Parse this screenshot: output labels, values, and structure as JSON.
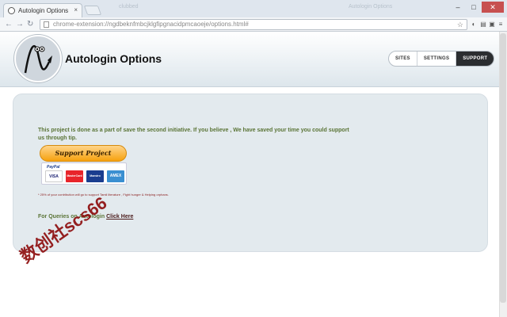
{
  "browser": {
    "tab_title": "Autologin Options",
    "tab_close": "×",
    "faded_tabs": [
      "clubbed",
      "Autologin Options"
    ],
    "url": "chrome-extension://ngdbeknfmbcjklgfipgnacidpmcaoeje/options.html#",
    "nav": {
      "back": "←",
      "forward": "→",
      "reload": "↻"
    },
    "star": "☆",
    "extensions": [
      "◐",
      "▤",
      "▣",
      "≡"
    ],
    "window_buttons": [
      "–",
      "□",
      "✕"
    ]
  },
  "header": {
    "title": "Autologin Options",
    "nav": [
      {
        "label": "SITES",
        "active": false
      },
      {
        "label": "SETTINGS",
        "active": false
      },
      {
        "label": "SUPPORT",
        "active": true
      }
    ]
  },
  "support": {
    "intro": "This project is done as a part of save the second initiative. If you believe , We have saved your time you could support us through tip.",
    "button": "Support Project",
    "paypal_label": "PayPal",
    "cards": [
      "VISA",
      "MasterCard",
      "Maestro",
      "AMEX"
    ],
    "footnote": "* 25% of your contribution will go to support Tamil literature , Fight hunger & Helping orphans.",
    "queries_prefix": "For Queries on Autologin",
    "queries_link": "Click Here"
  },
  "watermark": "数创社scs66",
  "colors": {
    "accent": "#5a7436",
    "active_nav": "#2b2d30",
    "card_bg": "#e3eaee",
    "button": "#f6a10e"
  }
}
